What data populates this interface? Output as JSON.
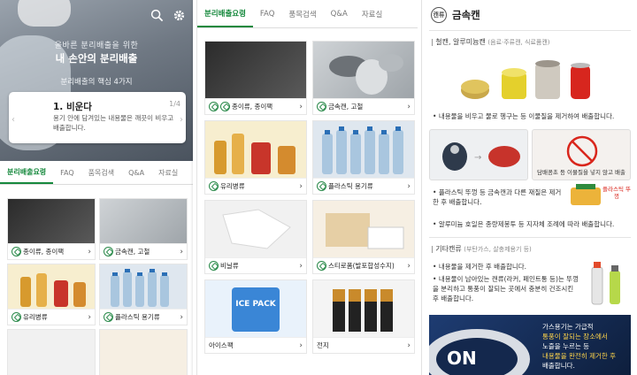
{
  "s1": {
    "hero": {
      "line1": "올바른 분리배출을 위한",
      "line2": "내 손안의 분리배출",
      "line3": "분리배출의 핵심 4가지"
    },
    "card": {
      "title": "1. 비운다",
      "page": "1/4",
      "desc": "용기 안에 담겨있는 내용물은 깨끗이 비우고 배출합니다."
    },
    "tabs": [
      "분리배출요령",
      "FAQ",
      "품목검색",
      "Q&A",
      "자료실"
    ],
    "tiles": [
      {
        "label": "종이류, 종이팩"
      },
      {
        "label": "금속캔, 고철"
      },
      {
        "label": "유리병류"
      },
      {
        "label": "플라스틱 용기류"
      },
      {
        "label": ""
      },
      {
        "label": ""
      }
    ]
  },
  "s2": {
    "tabs": [
      "분리배출요령",
      "FAQ",
      "품목검색",
      "Q&A",
      "자료실"
    ],
    "tiles": [
      {
        "label": "종이류, 종이팩"
      },
      {
        "label": "금속캔, 고철"
      },
      {
        "label": "유리병류"
      },
      {
        "label": "플라스틱 용기류"
      },
      {
        "label": "비닐류"
      },
      {
        "label": "스티로폼(발포합성수지)"
      },
      {
        "label": "아이스팩",
        "pack": "ICE PACK"
      },
      {
        "label": "전지"
      }
    ]
  },
  "s3": {
    "title": "금속캔",
    "icon_text": "캔류",
    "sec1": {
      "title": "철캔, 알루미늄캔",
      "sub": "(음료·주류캔, 식료품캔)"
    },
    "b1": "내용물을 비우고 물로 헹구는 등 이물질을 제거하여 배출합니다.",
    "photo_cap": "담배꽁초 등 이물질을 넣지 않고 배출",
    "b2": "플라스틱 뚜껑 등 금속캔과 다른 재질은 제거한 후 배출합니다.",
    "b3": "알루미늄 호일은 종량제봉투 등 지자체 조례에 따라 배출합니다.",
    "cap_label": "플라스틱 뚜껑",
    "sec2": {
      "title": "기타캔류",
      "sub": "(부탄가스, 살충제용기 등)"
    },
    "b4": "내용물을 제거한 후 배출합니다.",
    "b5": "내용물이 남아있는 캔류(라커, 페인트통 등)는 뚜껑을 분리하고 통풍이 잘되는 곳에서 충분히 건조시킨 후 배출합니다.",
    "dark": {
      "l1": "가스용기는 가급적",
      "l2": "통풍이 잘되는 장소에서",
      "l3": "노즐을 누르는 등",
      "l4": "내용물을 완전히 제거한 후",
      "l5": "배출합니다."
    }
  },
  "colors": {
    "accent": "#16893d"
  }
}
